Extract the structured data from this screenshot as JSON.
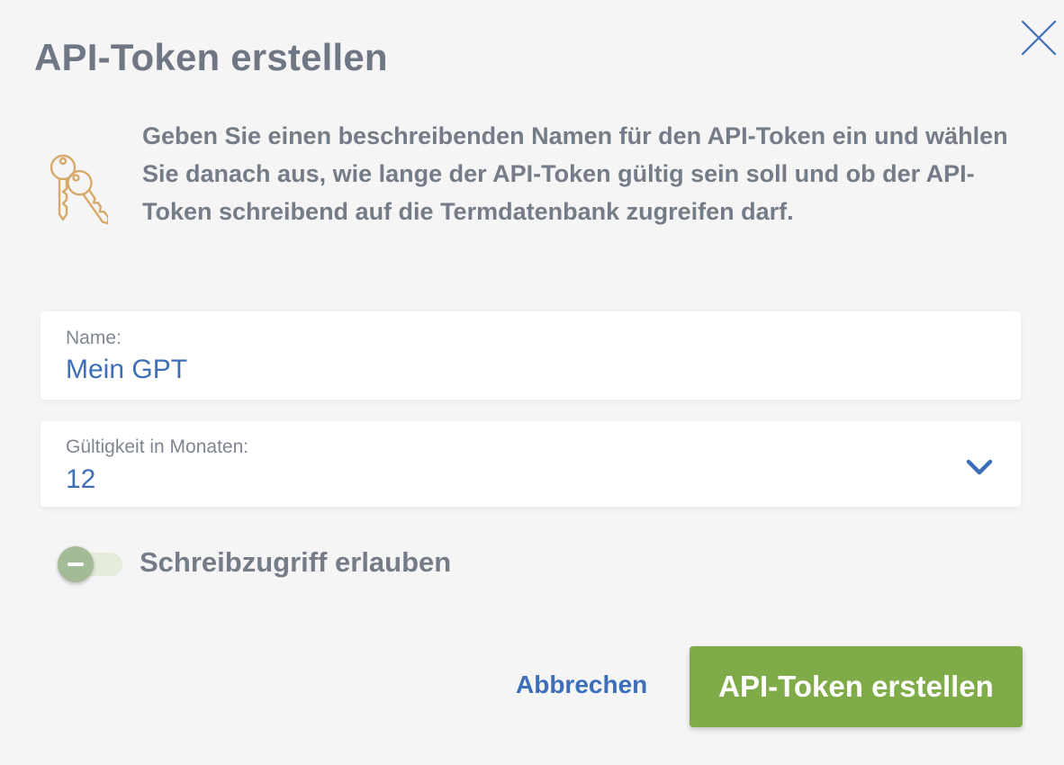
{
  "dialog": {
    "title": "API-Token erstellen",
    "close_icon": "close-icon",
    "key_icon": "keys-icon",
    "description": "Geben Sie einen beschreibenden Namen für den API-Token ein und wählen Sie danach aus, wie lange der API-Token gültig sein soll und ob der API-Token schreibend auf die Termdatenbank zugreifen darf."
  },
  "form": {
    "name": {
      "label": "Name:",
      "value": "Mein GPT"
    },
    "validity": {
      "label": "Gültigkeit in Monaten:",
      "value": "12",
      "icon": "chevron-down-icon"
    },
    "write_access": {
      "label": "Schreibzugriff erlauben",
      "enabled": false
    }
  },
  "actions": {
    "cancel_label": "Abbrechen",
    "create_label": "API-Token erstellen"
  },
  "colors": {
    "accent_blue": "#3d6eb8",
    "primary_green": "#7fab48",
    "key_gold": "#d6a86a",
    "text_gray": "#747c88"
  }
}
